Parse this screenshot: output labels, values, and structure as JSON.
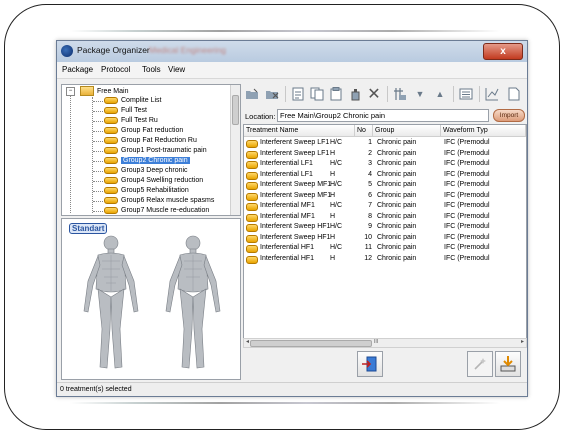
{
  "window": {
    "title": "Package Organizer",
    "title_blurred": "Medical Engineering",
    "close_glyph": "x"
  },
  "menu": {
    "items": [
      "Package",
      "Protocol",
      "Tools",
      "View"
    ]
  },
  "tree": {
    "root": "Free Main",
    "items": [
      "Complite List",
      "Full Test",
      "Full Test Ru",
      "Group Fat reduction",
      "Group Fat Reduction Ru",
      "Group1 Post-traumatic pain",
      "Group2 Chronic pain",
      "Group3 Deep chronic",
      "Group4 Swelling reduction",
      "Group5 Rehabilitation",
      "Group6 Relax muscle spasms",
      "Group7 Muscle re-education"
    ],
    "selected_index": 6
  },
  "body_panel": {
    "badge": "Standart"
  },
  "toolbar": {
    "icons": [
      "open-folder-icon",
      "delete-folder-icon",
      "new-doc-icon",
      "copy-icon",
      "paste-icon",
      "spray-icon",
      "delete-icon",
      "add-item-icon",
      "move-down-icon",
      "move-up-icon",
      "list-icon",
      "chart-icon",
      "document-icon"
    ]
  },
  "location": {
    "label": "Location:",
    "value": "Free Main\\Group2 Chronic pain",
    "import_label": "Import"
  },
  "table": {
    "columns": [
      "Treatment Name",
      "No",
      "Group",
      "Waveform Typ"
    ],
    "rows": [
      {
        "name": "Interferent Sweep LF1",
        "mode": "H/C",
        "no": "1",
        "group": "Chronic pain",
        "waveform": "IFC (Premodul"
      },
      {
        "name": "Interferent Sweep LF1",
        "mode": "H",
        "no": "2",
        "group": "Chronic pain",
        "waveform": "IFC (Premodul"
      },
      {
        "name": "Interferential LF1",
        "mode": "H/C",
        "no": "3",
        "group": "Chronic pain",
        "waveform": "IFC (Premodul"
      },
      {
        "name": "Interferential LF1",
        "mode": "H",
        "no": "4",
        "group": "Chronic pain",
        "waveform": "IFC (Premodul"
      },
      {
        "name": "Interferent Sweep MF1",
        "mode": "H/C",
        "no": "5",
        "group": "Chronic pain",
        "waveform": "IFC (Premodul"
      },
      {
        "name": "Interferent Sweep  MF1",
        "mode": "H",
        "no": "6",
        "group": "Chronic pain",
        "waveform": "IFC (Premodul"
      },
      {
        "name": "Interferential  MF1",
        "mode": "H/C",
        "no": "7",
        "group": "Chronic pain",
        "waveform": "IFC (Premodul"
      },
      {
        "name": "Interferential  MF1",
        "mode": "H",
        "no": "8",
        "group": "Chronic pain",
        "waveform": "IFC (Premodul"
      },
      {
        "name": "Interferent Sweep HF1",
        "mode": "H/C",
        "no": "9",
        "group": "Chronic pain",
        "waveform": "IFC (Premodul"
      },
      {
        "name": "Interferent Sweep HF1",
        "mode": "H",
        "no": "10",
        "group": "Chronic pain",
        "waveform": "IFC (Premodul"
      },
      {
        "name": "Interferential  HF1",
        "mode": "H/C",
        "no": "11",
        "group": "Chronic pain",
        "waveform": "IFC (Premodul"
      },
      {
        "name": "Interferential  HF1",
        "mode": "H",
        "no": "12",
        "group": "Chronic pain",
        "waveform": "IFC (Premodul"
      }
    ]
  },
  "hscroll": {
    "center_glyph": "III"
  },
  "status": {
    "text": "0 treatment(s) selected"
  }
}
